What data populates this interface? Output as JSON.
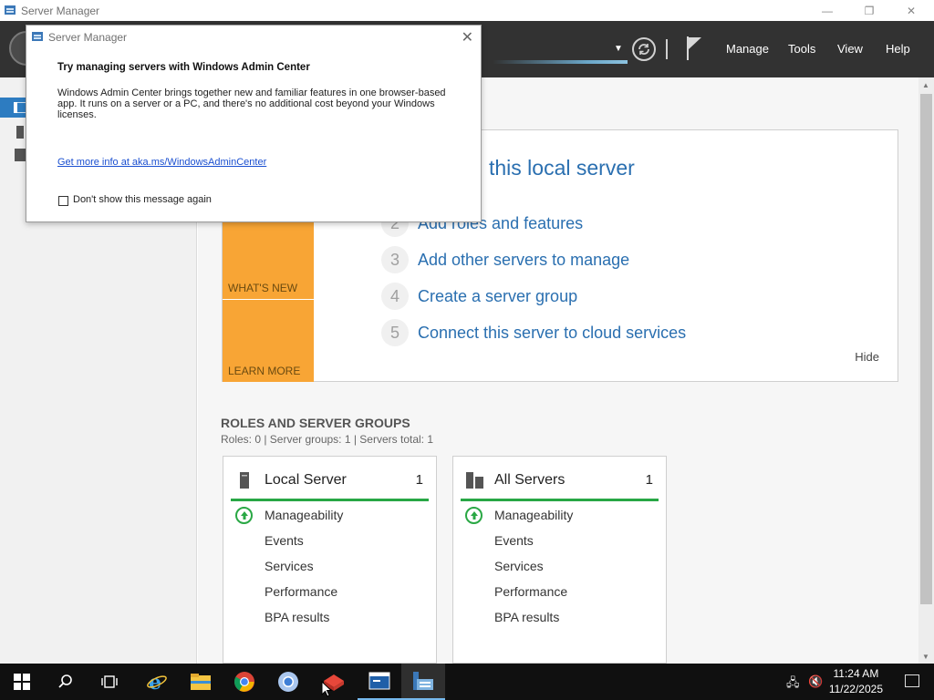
{
  "window": {
    "title": "Server Manager",
    "minimize": "—",
    "restore": "❐",
    "close": "✕"
  },
  "header": {
    "menu": [
      "Manage",
      "Tools",
      "View",
      "Help"
    ]
  },
  "welcome": {
    "headline": "this local server",
    "tiles": [
      "WHAT'S NEW",
      "LEARN MORE"
    ],
    "steps": [
      {
        "num": "2",
        "label": "Add roles and features"
      },
      {
        "num": "3",
        "label": "Add other servers to manage"
      },
      {
        "num": "4",
        "label": "Create a server group"
      },
      {
        "num": "5",
        "label": "Connect this server to cloud services"
      }
    ],
    "hide_label": "Hide"
  },
  "roles": {
    "title": "ROLES AND SERVER GROUPS",
    "summary": "Roles: 0   |   Server groups: 1   |   Servers total: 1"
  },
  "cards": [
    {
      "title": "Local Server",
      "count": "1",
      "rows": [
        "Manageability",
        "Events",
        "Services",
        "Performance",
        "BPA results"
      ]
    },
    {
      "title": "All Servers",
      "count": "1",
      "rows": [
        "Manageability",
        "Events",
        "Services",
        "Performance",
        "BPA results"
      ]
    }
  ],
  "dialog": {
    "title": "Server Manager",
    "close": "✕",
    "heading": "Try managing servers with Windows Admin Center",
    "body": "Windows Admin Center brings together new and familiar features in one browser-based app. It runs on a server or a PC, and there's no additional cost beyond your Windows licenses.",
    "link": "Get more info at aka.ms/WindowsAdminCenter",
    "checkbox_label": "Don't show this message again",
    "checkbox_checked": false
  },
  "taskbar": {
    "time": "11:24 AM",
    "date": "11/22/2025"
  },
  "colors": {
    "header_bg": "#323232",
    "accent_blue": "#2a6fb0",
    "tile_orange": "#f8a535",
    "status_green": "#28a745"
  }
}
